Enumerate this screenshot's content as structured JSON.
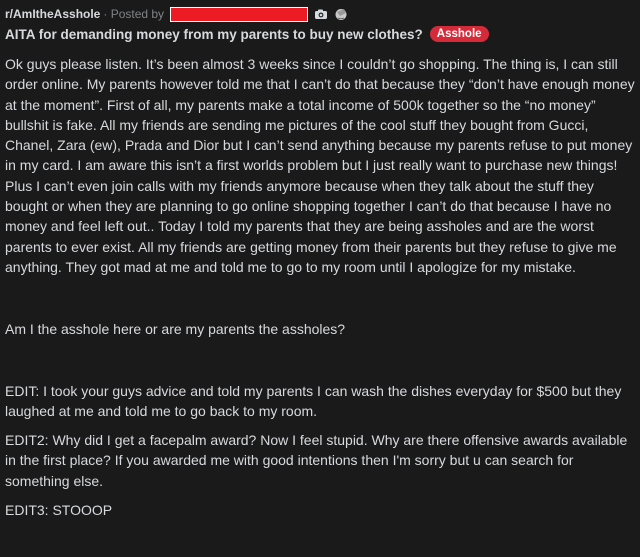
{
  "header": {
    "subreddit": "r/AmItheAsshole",
    "posted_by_label": "· Posted by"
  },
  "icons": {
    "awards": [
      "camera-award-icon",
      "facepalm-award-icon"
    ]
  },
  "post": {
    "title": "AITA for demanding money from my parents to buy new clothes?",
    "flair": "Asshole",
    "flair_color": "#d52a3a",
    "paragraphs": [
      "Ok guys please listen. It’s been almost 3 weeks since I couldn’t go shopping. The thing is, I can still order online. My parents however told me that I can’t do that because they “don’t have enough money at the moment”. First of all, my parents make a total income of 500k together so the “no money” bullshit is fake. All my friends are sending me pictures of the cool stuff they bought from Gucci, Chanel, Zara (ew), Prada and Dior but I can’t send anything because my parents refuse to put money in my card. I am aware this isn’t a first worlds problem but I just really want to purchase new things! Plus I can’t even join calls with my friends anymore because when they talk about the stuff they bought or when they are planning to go online shopping together I can’t do that because I have no money and feel left out.. Today I told my parents that they are being assholes and are the worst parents to ever exist. All my friends are getting money from their parents but they refuse to give me anything. They got mad at me and told me to go to my room until I apologize for my mistake.",
      "Am I the asshole here or are my parents the assholes?",
      "EDIT: I took your guys advice and told my parents I can wash the dishes everyday for $500 but they laughed at me and told me to go back to my room.",
      "EDIT2: Why did I get a facepalm award? Now I feel stupid. Why are there offensive awards available in the first place? If you awarded me with good intentions then I'm sorry but u can search for something else.",
      "EDIT3: STOOOP"
    ]
  }
}
